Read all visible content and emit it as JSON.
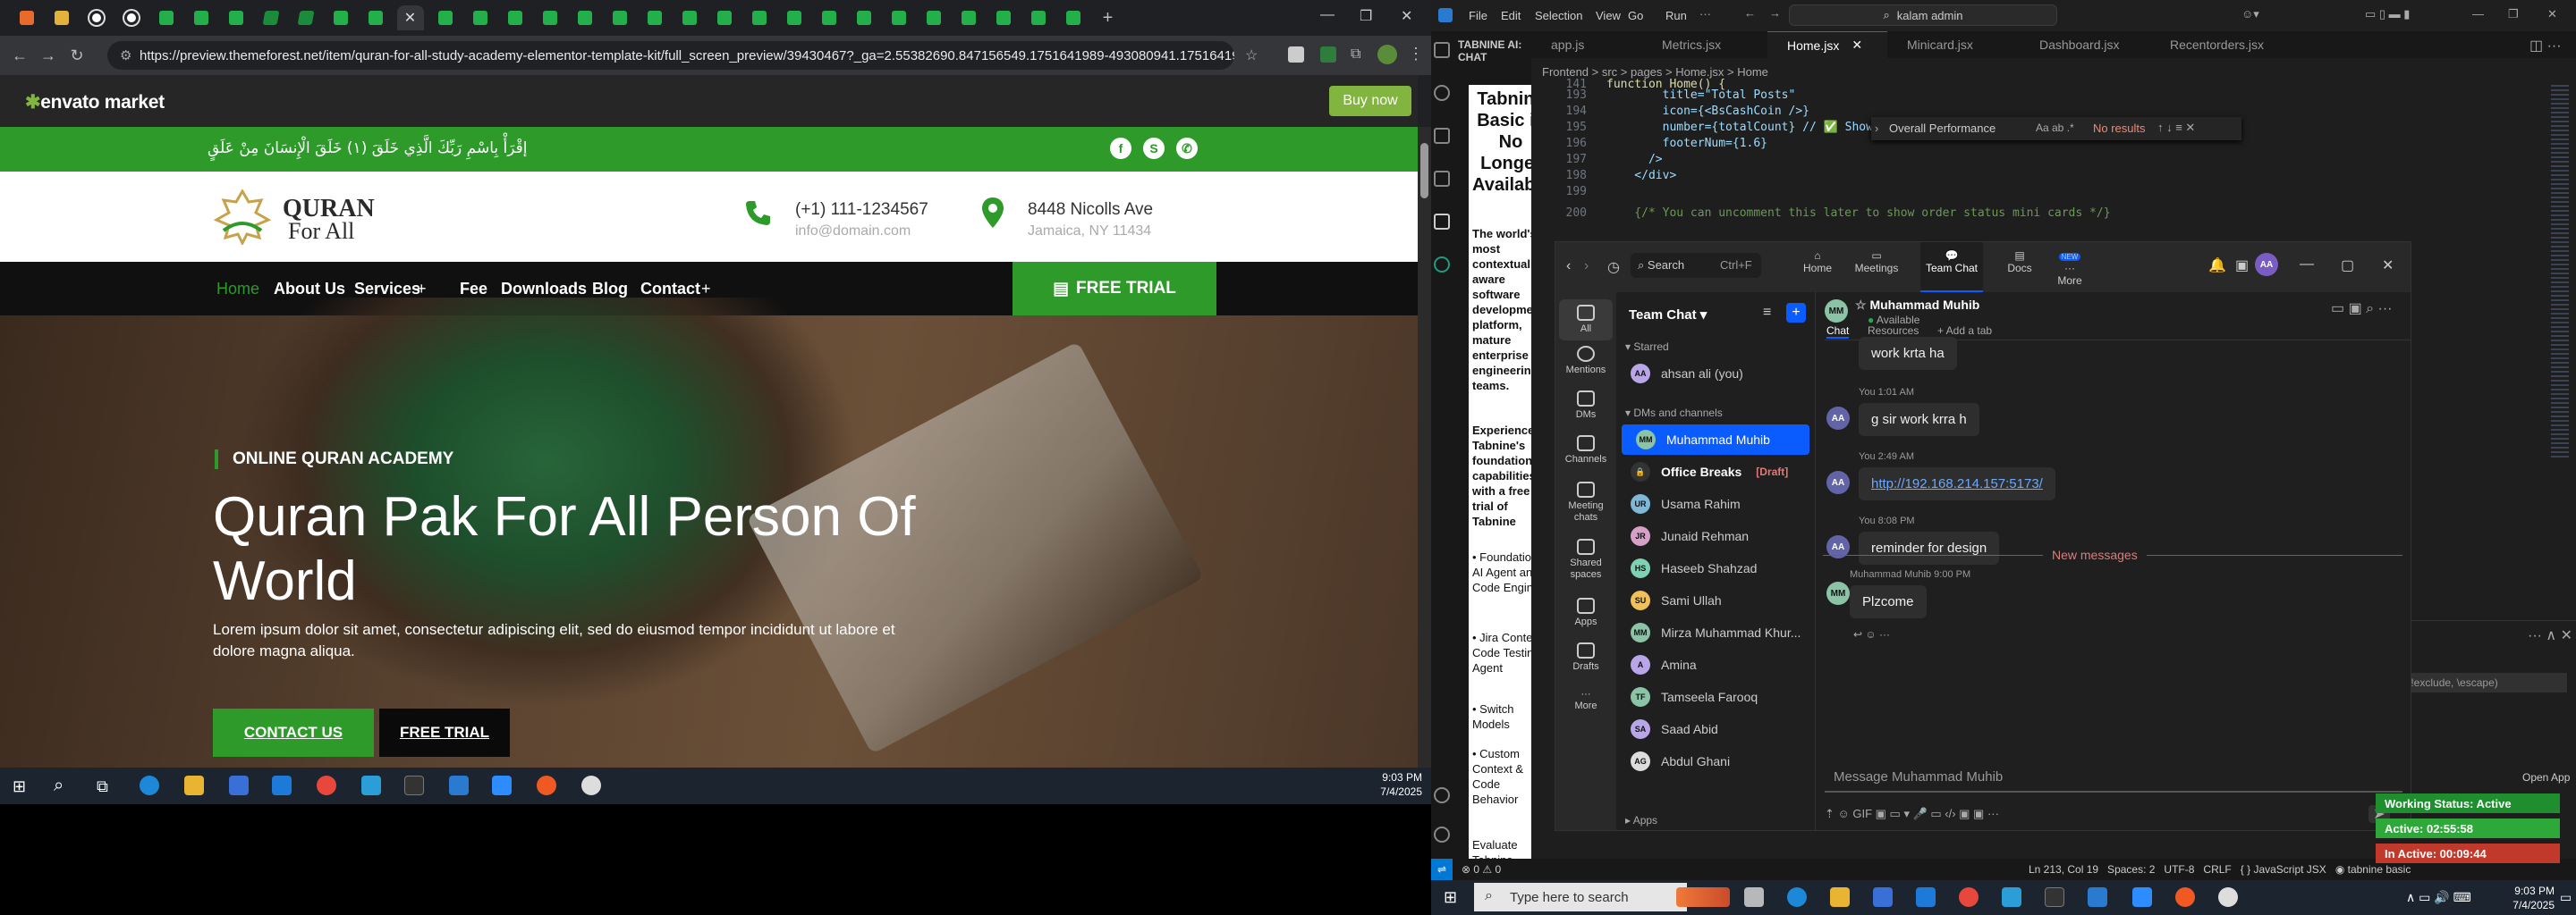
{
  "browser": {
    "url": "https://preview.themeforest.net/item/quran-for-all-study-academy-elementor-template-kit/full_screen_preview/39430467?_ga=2.55382690.847156549.1751641989-493080941.1751641989&_gac=...",
    "envato_logo": "envato market",
    "buy_now": "Buy now"
  },
  "site": {
    "arabic_verse": "إقْرَأْ بِاسْمِ رَبِّكَ الَّذِي خَلَقَ (١) خَلَقَ الْإِنسَانَ مِنْ عَلَقٍ",
    "logo_line1": "QURAN",
    "logo_line2": "For All",
    "phone": "(+1) 111-1234567",
    "email": "info@domain.com",
    "address_line1": "8448 Nicolls Ave",
    "address_line2": "Jamaica, NY 11434",
    "nav": [
      "Home",
      "About Us",
      "Services",
      "Fee",
      "Downloads",
      "Blog",
      "Contact"
    ],
    "free_trial_nav": "FREE TRIAL",
    "hero_tag": "ONLINE QURAN ACADEMY",
    "hero_title": "Quran Pak For All Person Of World",
    "hero_text": "Lorem ipsum dolor sit amet, consectetur adipiscing elit, sed do eiusmod tempor incididunt ut labore et dolore magna aliqua.",
    "contact_button": "CONTACT US",
    "free_trial_button": "FREE TRIAL"
  },
  "taskbar_left": {
    "time": "9:03 PM",
    "date": "7/4/2025"
  },
  "vscode": {
    "menu": [
      "File",
      "Edit",
      "Selection",
      "View",
      "Go",
      "Run"
    ],
    "command_center": "kalam admin",
    "chat_title": "TABNINE AI: CHAT",
    "tabnine_title": "Tabnine Basic is No Longer Available",
    "tabnine_text": "The world's most contextually aware software development platform, mature enterprise engineering teams.",
    "tabnine_more": "Experience Tabnine's foundational capabilities with a free trial of Tabnine",
    "tabnine_bullets": [
      "Foundational AI Agent and Code Engine",
      "Jira Context Code Testing Agent",
      "Switch Models",
      "Custom Context & Code Behavior"
    ],
    "tabnine_footer": "Evaluate Tabnine Enterprise:",
    "tabs": [
      "app.js",
      "Metrics.jsx",
      "Home.jsx",
      "Minicard.jsx",
      "Dashboard.jsx",
      "Recentorders.jsx"
    ],
    "breadcrumb": "Frontend > src > pages > Home.jsx > Home",
    "code_lines": [
      {
        "n": "141",
        "t": "function Home() {"
      },
      {
        "n": "193",
        "t": "        title=\"Total Posts\""
      },
      {
        "n": "194",
        "t": "        icon={<BsCashCoin />}"
      },
      {
        "n": "195",
        "t": "        number={totalCount} // ✅ Show dynamic total count"
      },
      {
        "n": "196",
        "t": "        footerNum={1.6}"
      },
      {
        "n": "197",
        "t": "      />"
      },
      {
        "n": "198",
        "t": "    </div>"
      },
      {
        "n": "199",
        "t": ""
      },
      {
        "n": "200",
        "t": "    {/* You can uncomment this later to show order status mini cards */}"
      }
    ],
    "find_query": "Overall Performance",
    "find_result": "No results",
    "status_left": "⊗ 0 ⚠ 0",
    "status_right": "Ln 213, Col 19   Spaces: 2   UTF-8   CRLF   { } JavaScript JSX   ◉ tabnine basic",
    "panel_placeholder": "(e.g. *.ts, !exclude, \\escape)",
    "open_app": "Open App"
  },
  "teams": {
    "search": "Search",
    "search_hint": "Ctrl+F",
    "top_nav": [
      "Home",
      "Meetings",
      "Team Chat",
      "Docs",
      "More"
    ],
    "new_badge": "NEW",
    "user_initials": "AA",
    "rail": [
      "All",
      "Mentions",
      "DMs",
      "Channels",
      "Meeting chats",
      "Shared spaces",
      "Apps",
      "Drafts",
      "More"
    ],
    "list_title": "Team Chat",
    "starred": "Starred",
    "dms_header": "DMs and channels",
    "apps_header": "Apps",
    "contacts": [
      {
        "initials": "AA",
        "name": "ahsan ali (you)",
        "color": "#b8a6e8"
      },
      {
        "initials": "MM",
        "name": "Muhammad Muhib",
        "color": "#8bc3a6"
      },
      {
        "initials": "🔒",
        "name": "Office Breaks",
        "color": "#333333",
        "draft": "[Draft]"
      },
      {
        "initials": "UR",
        "name": "Usama Rahim",
        "color": "#7fb7d9"
      },
      {
        "initials": "JR",
        "name": "Junaid Rehman",
        "color": "#d6a0c8"
      },
      {
        "initials": "HS",
        "name": "Haseeb Shahzad",
        "color": "#7fd1b3"
      },
      {
        "initials": "SU",
        "name": "Sami Ullah",
        "color": "#f0c05a"
      },
      {
        "initials": "MM",
        "name": "Mirza Muhammad Khur...",
        "color": "#8bc3a6"
      },
      {
        "initials": "A",
        "name": "Amina",
        "color": "#b8a6e8"
      },
      {
        "initials": "TF",
        "name": "Tamseela Farooq",
        "color": "#8bc3a6"
      },
      {
        "initials": "SA",
        "name": "Saad Abid",
        "color": "#b8a6e8"
      },
      {
        "initials": "AG",
        "name": "Abdul Ghani",
        "color": "#dddddd"
      }
    ],
    "chat_name": "Muhammad Muhib",
    "chat_status": "Available",
    "chat_tabs": [
      "Chat",
      "Resources",
      "+ Add a tab"
    ],
    "messages": [
      {
        "meta": "",
        "text": "work krta ha",
        "link": false
      },
      {
        "meta": "You 1:01 AM",
        "text": "g sir work krra h",
        "link": false
      },
      {
        "meta": "You 2:49 AM",
        "text": "http://192.168.214.157:5173/",
        "link": true
      },
      {
        "meta": "You 8:08 PM",
        "text": "reminder for design",
        "link": false
      }
    ],
    "new_messages": "New messages",
    "incoming": {
      "meta": "Muhammad Muhib 9:00 PM",
      "text": "Plzcome",
      "initials": "MM"
    },
    "compose_placeholder": "Message Muhammad Muhib"
  },
  "tabnine_status": [
    "Working Status: Active",
    "Active: 02:55:58",
    "In Active: 00:09:44"
  ],
  "taskbar_right": {
    "search": "Type here to search",
    "time": "9:03 PM",
    "date": "7/4/2025"
  }
}
